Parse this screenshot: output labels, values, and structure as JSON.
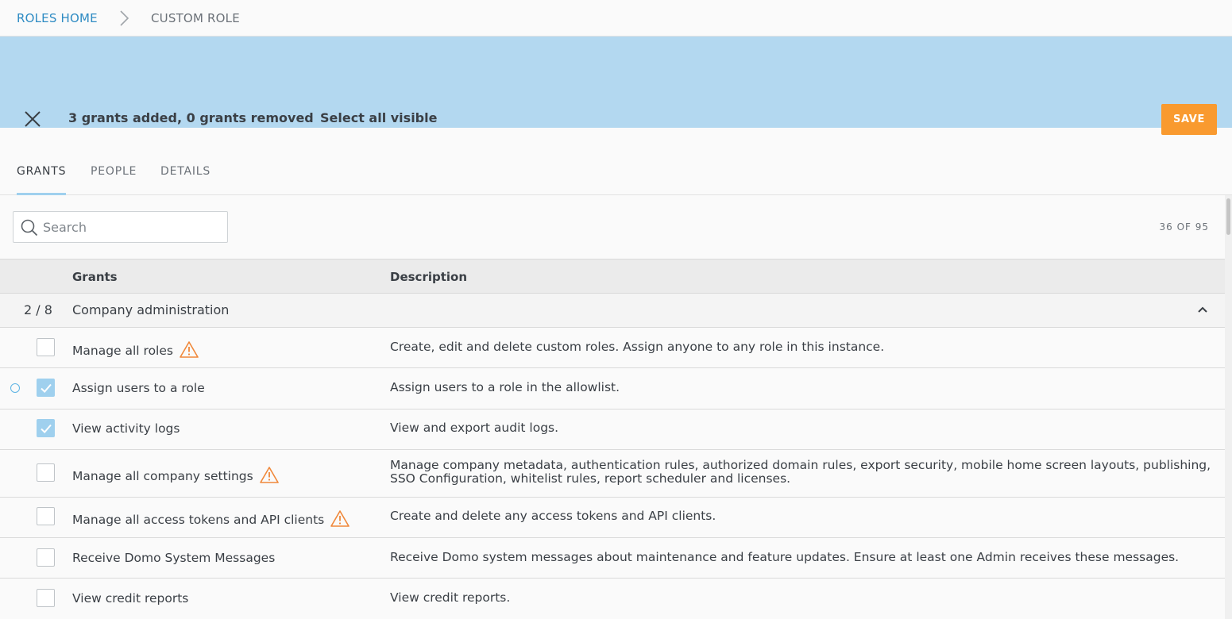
{
  "breadcrumb": {
    "home": "ROLES HOME",
    "current": "CUSTOM ROLE"
  },
  "banner": {
    "status": "3 grants added, 0 grants removed",
    "select_all": "Select all visible",
    "save_label": "SAVE"
  },
  "tabs": [
    {
      "label": "GRANTS",
      "active": true
    },
    {
      "label": "PEOPLE",
      "active": false
    },
    {
      "label": "DETAILS",
      "active": false
    }
  ],
  "search": {
    "placeholder": "Search",
    "value": ""
  },
  "count_label": "36 OF 95",
  "table": {
    "headers": {
      "grants": "Grants",
      "description": "Description"
    },
    "group": {
      "count": "2 / 8",
      "name": "Company administration",
      "expanded": true
    },
    "rows": [
      {
        "name": "Manage all roles",
        "warning": true,
        "checked": false,
        "description": "Create, edit and delete custom roles. Assign anyone to any role in this instance."
      },
      {
        "name": "Assign users to a role",
        "warning": false,
        "checked": true,
        "changed": true,
        "description": "Assign users to a role in the allowlist."
      },
      {
        "name": "View activity logs",
        "warning": false,
        "checked": true,
        "description": "View and export audit logs."
      },
      {
        "name": "Manage all company settings",
        "warning": true,
        "checked": false,
        "description": "Manage company metadata, authentication rules, authorized domain rules, export security, mobile home screen layouts, publishing, SSO Configuration, whitelist rules, report scheduler and licenses."
      },
      {
        "name": "Manage all access tokens and API clients",
        "warning": true,
        "checked": false,
        "description": "Create and delete any access tokens and API clients."
      },
      {
        "name": "Receive Domo System Messages",
        "warning": false,
        "checked": false,
        "description": "Receive Domo system messages about maintenance and feature updates. Ensure at least one Admin receives these messages."
      },
      {
        "name": "View credit reports",
        "warning": false,
        "checked": false,
        "description": "View credit reports."
      }
    ]
  },
  "colors": {
    "banner": "#b3d8f0",
    "save": "#f99a2f",
    "link": "#2e8bc3",
    "checkbox_checked": "#9fd0ee",
    "warning": "#f0883a"
  },
  "icons": {
    "close": "close-icon",
    "breadcrumb_separator": "chevron-right-icon",
    "search": "search-icon",
    "collapse": "chevron-up-icon",
    "warning": "warning-icon",
    "check": "check-icon"
  }
}
